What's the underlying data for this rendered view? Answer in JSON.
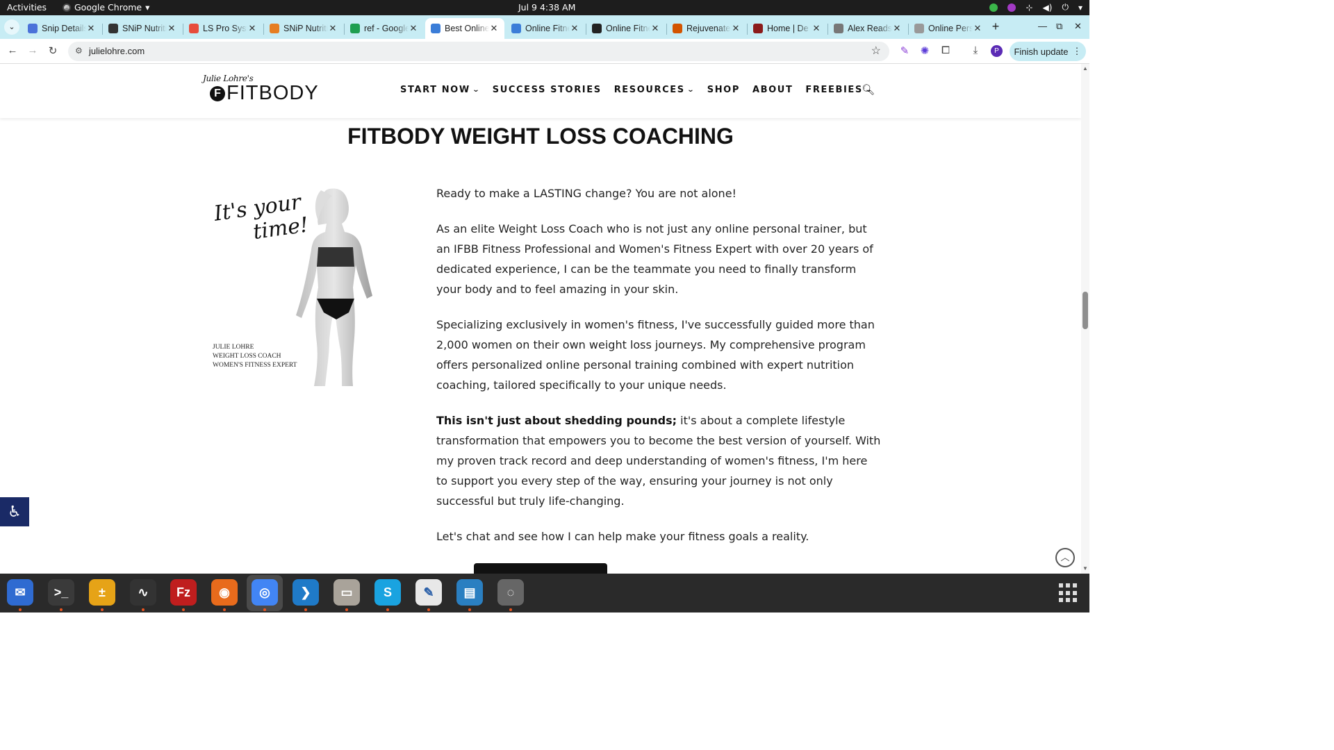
{
  "os": {
    "activities": "Activities",
    "app_name": "Google Chrome",
    "clock": "Jul 9  4:38 AM"
  },
  "tabs": [
    {
      "title": "Snip Details",
      "favicon_color": "#4b72d9"
    },
    {
      "title": "SNiP Nutrition",
      "favicon_color": "#333333"
    },
    {
      "title": "LS Pro Systems",
      "favicon_color": "#e74c3c"
    },
    {
      "title": "SNiP Nutrition",
      "favicon_color": "#e67e22"
    },
    {
      "title": "ref - Google Sheets",
      "favicon_color": "#1e9e50"
    },
    {
      "title": "Best Online",
      "favicon_color": "#3b7dd8",
      "active": true
    },
    {
      "title": "Online Fitness",
      "favicon_color": "#3b7dd8"
    },
    {
      "title": "Online Fitness",
      "favicon_color": "#222222"
    },
    {
      "title": "Rejuvenate",
      "favicon_color": "#d35400"
    },
    {
      "title": "Home | De",
      "favicon_color": "#8b1a1a"
    },
    {
      "title": "Alex Reads",
      "favicon_color": "#777777"
    },
    {
      "title": "Online Personal",
      "favicon_color": "#999999"
    }
  ],
  "toolbar": {
    "url": "julielohre.com",
    "finish_update": "Finish update",
    "profile_initial": "P"
  },
  "site": {
    "logo_script": "Julie Lohre's",
    "logo_mark": "F",
    "logo_word": "FITBODY",
    "nav": [
      {
        "label": "START NOW",
        "chevron": true
      },
      {
        "label": "SUCCESS STORIES",
        "chevron": false
      },
      {
        "label": "RESOURCES",
        "chevron": true
      },
      {
        "label": "SHOP",
        "chevron": false
      },
      {
        "label": "ABOUT",
        "chevron": false
      },
      {
        "label": "FREEBIES",
        "chevron": true
      }
    ],
    "page_title": "FITBODY WEIGHT LOSS COACHING",
    "hero": {
      "tagline_1": "It's your",
      "tagline_2": "time!",
      "caption_1": "JULIE LOHRE",
      "caption_2": "WEIGHT LOSS COACH",
      "caption_3": "WOMEN'S FITNESS EXPERT"
    },
    "paragraphs": {
      "p1": "Ready to make a LASTING change?  You are not alone!",
      "p2": "As an elite Weight Loss Coach who is not just any online personal trainer, but an IFBB Fitness Professional and Women's Fitness Expert with over 20 years of dedicated experience, I can be the teammate you need to finally transform your body and to feel amazing in your skin.",
      "p3": "Specializing exclusively in women's fitness, I've successfully guided more than 2,000 women on their own weight loss journeys. My comprehensive program offers personalized online personal training combined with expert nutrition coaching, tailored specifically to your unique needs.",
      "p4_bold": "This isn't just about shedding pounds;",
      "p4_rest": " it's about a complete lifestyle transformation that empowers you to become the best version of yourself. With my proven track record and deep understanding of women's fitness, I'm here to support you every step of the way, ensuring your journey is not only successful but truly life-changing.",
      "p5": "Let's chat and see how I can help make your fitness goals a reality."
    }
  },
  "dock": [
    {
      "name": "thunderbird",
      "color": "#2f6bd1",
      "glyph": "✉"
    },
    {
      "name": "terminal",
      "color": "#3a3a3a",
      "glyph": ">_"
    },
    {
      "name": "calculator",
      "color": "#e6a317",
      "glyph": "±"
    },
    {
      "name": "system-monitor",
      "color": "#333333",
      "glyph": "∿"
    },
    {
      "name": "filezilla",
      "color": "#bf1e1e",
      "glyph": "Fz"
    },
    {
      "name": "firefox",
      "color": "#e86b1c",
      "glyph": "◉"
    },
    {
      "name": "chrome",
      "color": "#4285f4",
      "glyph": "◎"
    },
    {
      "name": "vscode",
      "color": "#1f7ac8",
      "glyph": "❯"
    },
    {
      "name": "files",
      "color": "#a9a39a",
      "glyph": "▭"
    },
    {
      "name": "skype",
      "color": "#1aa3e0",
      "glyph": "S"
    },
    {
      "name": "text-editor",
      "color": "#e8e8e8",
      "glyph": "✎"
    },
    {
      "name": "libreoffice-writer",
      "color": "#2a7fc1",
      "glyph": "▤"
    },
    {
      "name": "disk-utility",
      "color": "#666666",
      "glyph": "◌"
    }
  ]
}
